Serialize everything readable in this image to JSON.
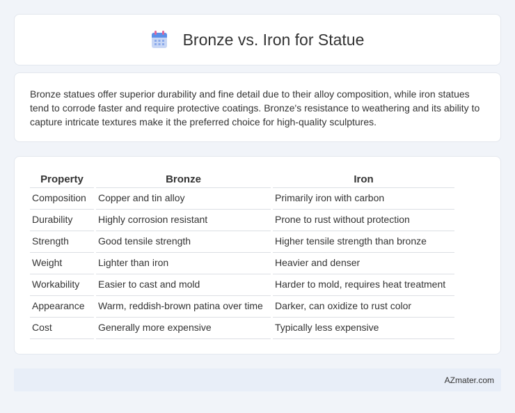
{
  "header": {
    "title": "Bronze vs. Iron for Statue",
    "icon": "calendar-icon"
  },
  "description": "Bronze statues offer superior durability and fine detail due to their alloy composition, while iron statues tend to corrode faster and require protective coatings. Bronze's resistance to weathering and its ability to capture intricate textures make it the preferred choice for high-quality sculptures.",
  "table": {
    "headers": [
      "Property",
      "Bronze",
      "Iron"
    ],
    "rows": [
      [
        "Composition",
        "Copper and tin alloy",
        "Primarily iron with carbon"
      ],
      [
        "Durability",
        "Highly corrosion resistant",
        "Prone to rust without protection"
      ],
      [
        "Strength",
        "Good tensile strength",
        "Higher tensile strength than bronze"
      ],
      [
        "Weight",
        "Lighter than iron",
        "Heavier and denser"
      ],
      [
        "Workability",
        "Easier to cast and mold",
        "Harder to mold, requires heat treatment"
      ],
      [
        "Appearance",
        "Warm, reddish-brown patina over time",
        "Darker, can oxidize to rust color"
      ],
      [
        "Cost",
        "Generally more expensive",
        "Typically less expensive"
      ]
    ]
  },
  "footer": {
    "brand": "AZmater.com"
  }
}
